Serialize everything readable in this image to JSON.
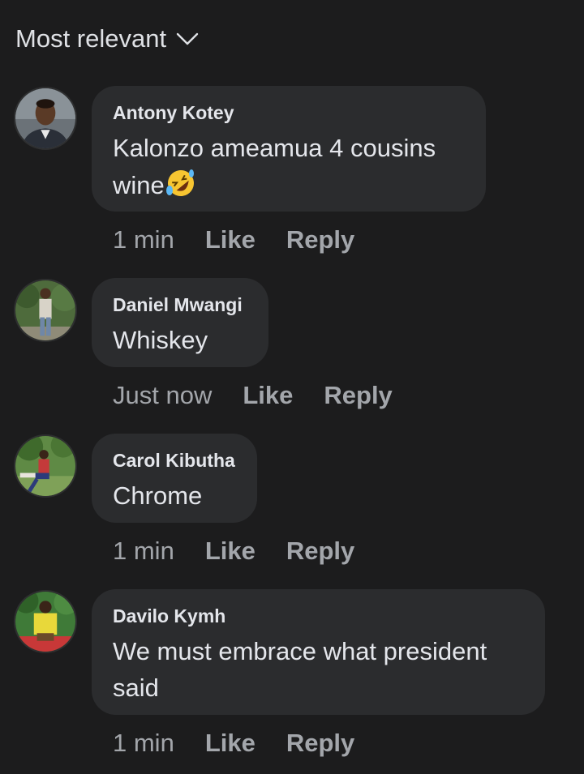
{
  "sort": {
    "label": "Most relevant",
    "icon": "chevron-down-icon"
  },
  "comments": [
    {
      "author": "Antony Kotey",
      "text": "Kalonzo ameamua 4 cousins",
      "text_line2": "wine",
      "emoji": "rolling-on-floor-laughing-emoji",
      "time": "1 min",
      "like": "Like",
      "reply": "Reply"
    },
    {
      "author": "Daniel Mwangi",
      "text": "Whiskey",
      "time": "Just now",
      "like": "Like",
      "reply": "Reply"
    },
    {
      "author": "Carol Kibutha",
      "text": "Chrome",
      "time": "1 min",
      "like": "Like",
      "reply": "Reply"
    },
    {
      "author": "Davilo Kymh",
      "text": "We must embrace what president",
      "text_line2": "said",
      "time": "1 min",
      "like": "Like",
      "reply": "Reply"
    }
  ],
  "colors": {
    "background": "#1c1c1d",
    "bubble": "#2b2c2e",
    "primary_text": "#e4e6eb",
    "secondary_text": "#a3a6ab"
  }
}
